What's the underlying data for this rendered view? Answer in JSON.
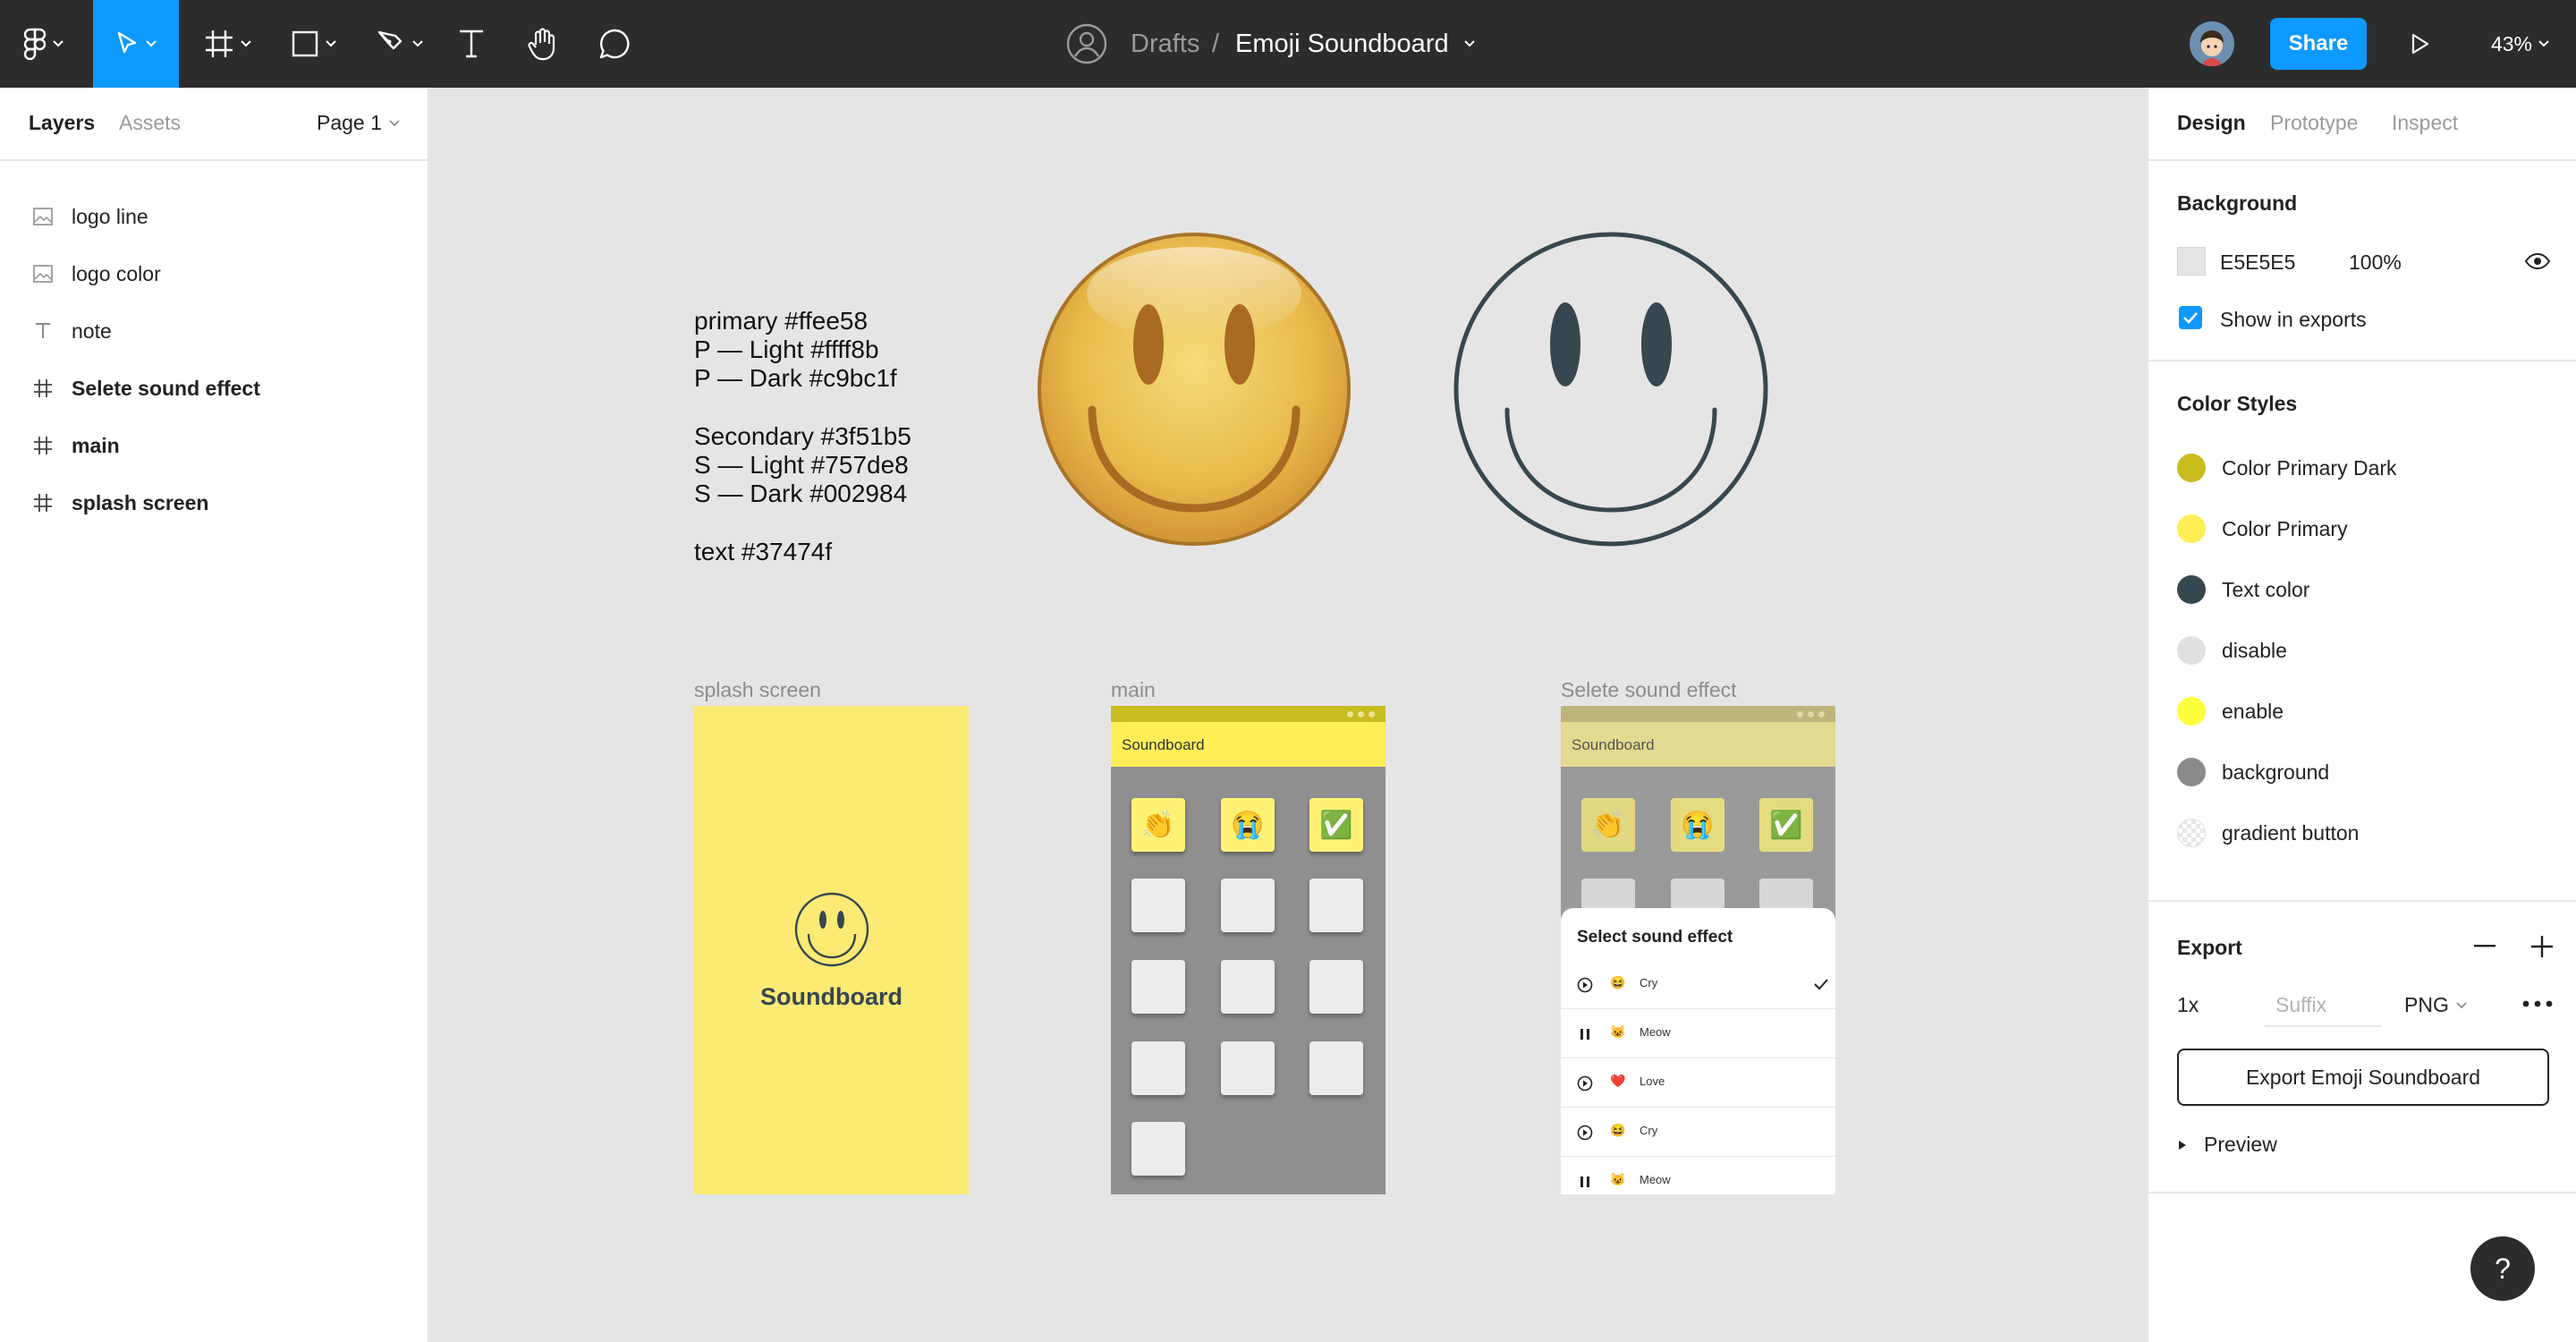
{
  "toolbar": {
    "breadcrumb_parent": "Drafts",
    "breadcrumb_sep": "/",
    "file_name": "Emoji Soundboard",
    "share_label": "Share",
    "zoom": "43%"
  },
  "left_panel": {
    "tabs": [
      "Layers",
      "Assets"
    ],
    "page": "Page 1",
    "layers": [
      {
        "name": "logo line",
        "icon": "image-icon"
      },
      {
        "name": "logo color",
        "icon": "image-icon"
      },
      {
        "name": "note",
        "icon": "text-icon"
      },
      {
        "name": "Selete sound effect",
        "icon": "frame-icon"
      },
      {
        "name": "main",
        "icon": "frame-icon"
      },
      {
        "name": "splash screen",
        "icon": "frame-icon"
      }
    ]
  },
  "canvas": {
    "note_lines": [
      "primary #ffee58",
      "P — Light #ffff8b",
      "P — Dark #c9bc1f",
      "Secondary #3f51b5",
      "S — Light #757de8",
      "S — Dark #002984",
      "text #37474f"
    ],
    "frames": {
      "splash": {
        "label": "splash screen",
        "title": "Soundboard",
        "bg": "#fcea74"
      },
      "main": {
        "label": "main",
        "appbar_title": "Soundboard",
        "tiles": [
          "👏",
          "😭",
          "✅"
        ]
      },
      "select": {
        "label": "Selete sound effect",
        "appbar_title": "Soundboard",
        "tiles": [
          "👏",
          "😭",
          "✅"
        ],
        "sheet_title": "Select sound effect",
        "sounds": [
          {
            "emoji": "😆",
            "label": "Cry",
            "state": "play",
            "checked": true
          },
          {
            "emoji": "😺",
            "label": "Meow",
            "state": "pause",
            "checked": false
          },
          {
            "emoji": "❤️",
            "label": "Love",
            "state": "play",
            "checked": false
          },
          {
            "emoji": "😆",
            "label": "Cry",
            "state": "play",
            "checked": false
          },
          {
            "emoji": "😺",
            "label": "Meow",
            "state": "pause",
            "checked": false
          }
        ]
      }
    }
  },
  "right_panel": {
    "tabs": [
      "Design",
      "Prototype",
      "Inspect"
    ],
    "background": {
      "title": "Background",
      "hex": "E5E5E5",
      "opacity": "100%",
      "show_in_exports": "Show in exports"
    },
    "color_styles": {
      "title": "Color Styles",
      "items": [
        {
          "name": "Color Primary Dark",
          "color": "#c9bc1f"
        },
        {
          "name": "Color Primary",
          "color": "#ffee58"
        },
        {
          "name": "Text color",
          "color": "#37474f"
        },
        {
          "name": "disable",
          "color": "#e0e0e0"
        },
        {
          "name": "enable",
          "color": "#ffff3c"
        },
        {
          "name": "background",
          "color": "#8a8a8a"
        },
        {
          "name": "gradient button",
          "color": "checker"
        }
      ]
    },
    "export": {
      "title": "Export",
      "scale": "1x",
      "suffix_placeholder": "Suffix",
      "format": "PNG",
      "button_label": "Export Emoji Soundboard",
      "preview_label": "Preview"
    }
  },
  "help_label": "?"
}
